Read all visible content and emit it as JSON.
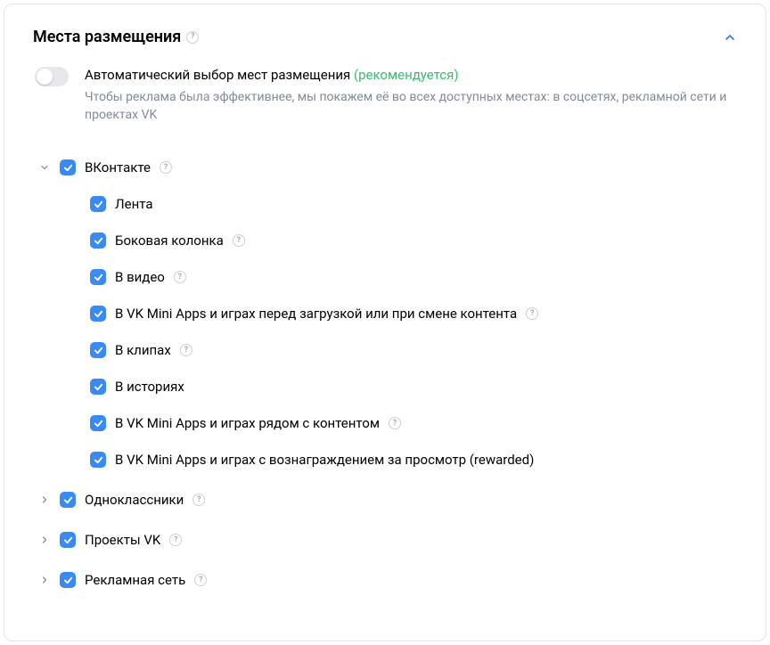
{
  "panel": {
    "title": "Места размещения"
  },
  "auto": {
    "title_main": "Автоматический выбор мест размещения ",
    "title_hint": "(рекомендуется)",
    "description": "Чтобы реклама была эффективнее, мы покажем её во всех доступных местах: в соцсетях, рекламной сети и проектах VK"
  },
  "tree": {
    "vk": {
      "label": "ВКонтакте",
      "children": {
        "feed": "Лента",
        "side": "Боковая колонка",
        "video": "В видео",
        "miniapps_load": "В VK Mini Apps и играх перед загрузкой или при смене контента",
        "clips": "В клипах",
        "stories": "В историях",
        "miniapps_near": "В VK Mini Apps и играх рядом с контентом",
        "miniapps_reward": "В VK Mini Apps и играх с вознаграждением за просмотр (rewarded)"
      }
    },
    "ok": {
      "label": "Одноклассники"
    },
    "projects": {
      "label": "Проекты VK"
    },
    "adnet": {
      "label": "Рекламная сеть"
    }
  }
}
